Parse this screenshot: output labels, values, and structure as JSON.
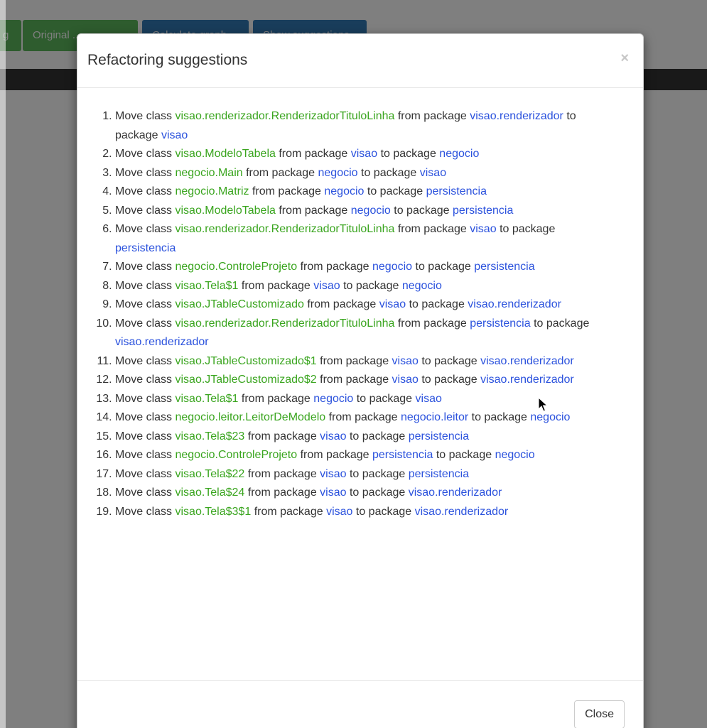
{
  "background": {
    "toolbar_buttons": [
      "g",
      "Original ...",
      "Calculate graph",
      "Show suggestions"
    ]
  },
  "modal": {
    "title": "Refactoring suggestions",
    "close_icon": "×",
    "close_button_label": "Close",
    "suggestions": [
      {
        "prefix": "Move class",
        "cls": "visao.renderizador.RenderizadorTituloLinha",
        "from_label": "from package",
        "from": "visao.renderizador",
        "to_label": "to package",
        "to": "visao"
      },
      {
        "prefix": "Move class",
        "cls": "visao.ModeloTabela",
        "from_label": "from package",
        "from": "visao",
        "to_label": "to package",
        "to": "negocio"
      },
      {
        "prefix": "Move class",
        "cls": "negocio.Main",
        "from_label": "from package",
        "from": "negocio",
        "to_label": "to package",
        "to": "visao"
      },
      {
        "prefix": "Move class",
        "cls": "negocio.Matriz",
        "from_label": "from package",
        "from": "negocio",
        "to_label": "to package",
        "to": "persistencia"
      },
      {
        "prefix": "Move class",
        "cls": "visao.ModeloTabela",
        "from_label": "from package",
        "from": "negocio",
        "to_label": "to package",
        "to": "persistencia"
      },
      {
        "prefix": "Move class",
        "cls": "visao.renderizador.RenderizadorTituloLinha",
        "from_label": "from package",
        "from": "visao",
        "to_label": "to package",
        "to": "persistencia"
      },
      {
        "prefix": "Move class",
        "cls": "negocio.ControleProjeto",
        "from_label": "from package",
        "from": "negocio",
        "to_label": "to package",
        "to": "persistencia"
      },
      {
        "prefix": "Move class",
        "cls": "visao.Tela$1",
        "from_label": "from package",
        "from": "visao",
        "to_label": "to package",
        "to": "negocio"
      },
      {
        "prefix": "Move class",
        "cls": "visao.JTableCustomizado",
        "from_label": "from package",
        "from": "visao",
        "to_label": "to package",
        "to": "visao.renderizador"
      },
      {
        "prefix": "Move class",
        "cls": "visao.renderizador.RenderizadorTituloLinha",
        "from_label": "from package",
        "from": "persistencia",
        "to_label": "to package",
        "to": "visao.renderizador"
      },
      {
        "prefix": "Move class",
        "cls": "visao.JTableCustomizado$1",
        "from_label": "from package",
        "from": "visao",
        "to_label": "to package",
        "to": "visao.renderizador"
      },
      {
        "prefix": "Move class",
        "cls": "visao.JTableCustomizado$2",
        "from_label": "from package",
        "from": "visao",
        "to_label": "to package",
        "to": "visao.renderizador"
      },
      {
        "prefix": "Move class",
        "cls": "visao.Tela$1",
        "from_label": "from package",
        "from": "negocio",
        "to_label": "to package",
        "to": "visao"
      },
      {
        "prefix": "Move class",
        "cls": "negocio.leitor.LeitorDeModelo",
        "from_label": "from package",
        "from": "negocio.leitor",
        "to_label": "to package",
        "to": "negocio"
      },
      {
        "prefix": "Move class",
        "cls": "visao.Tela$23",
        "from_label": "from package",
        "from": "visao",
        "to_label": "to package",
        "to": "persistencia"
      },
      {
        "prefix": "Move class",
        "cls": "negocio.ControleProjeto",
        "from_label": "from package",
        "from": "persistencia",
        "to_label": "to package",
        "to": "negocio"
      },
      {
        "prefix": "Move class",
        "cls": "visao.Tela$22",
        "from_label": "from package",
        "from": "visao",
        "to_label": "to package",
        "to": "persistencia"
      },
      {
        "prefix": "Move class",
        "cls": "visao.Tela$24",
        "from_label": "from package",
        "from": "visao",
        "to_label": "to package",
        "to": "visao.renderizador"
      },
      {
        "prefix": "Move class",
        "cls": "visao.Tela$3$1",
        "from_label": "from package",
        "from": "visao",
        "to_label": "to package",
        "to": "visao.renderizador"
      }
    ]
  },
  "colors": {
    "class_name": "#3aa51f",
    "package_name": "#2b52dd",
    "text": "#333333",
    "backdrop": "rgba(0,0,0,0.5)"
  }
}
